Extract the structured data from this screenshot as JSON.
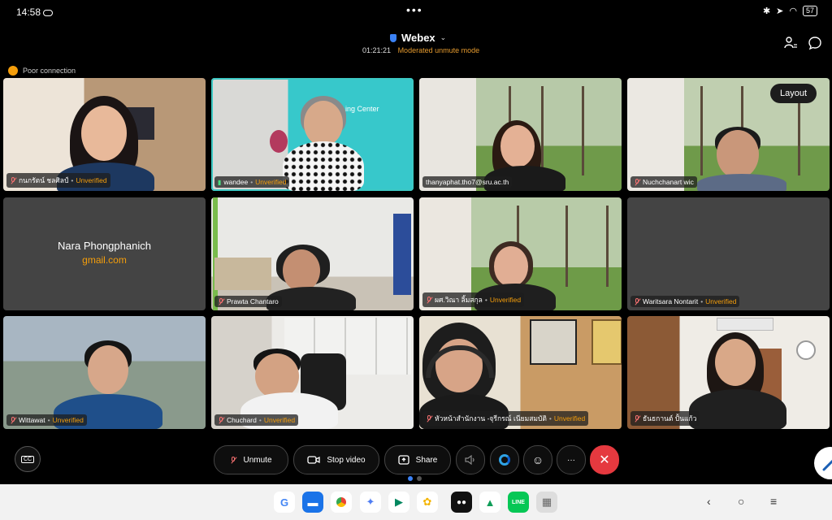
{
  "status": {
    "time": "14:58",
    "battery": "57"
  },
  "header": {
    "app_title": "Webex",
    "timer": "01:21:21",
    "mode": "Moderated unmute mode"
  },
  "connection": {
    "text": "Poor connection"
  },
  "layout_button": "Layout",
  "tiles": [
    {
      "name": "กนกรัตน์ ชลศิลป์",
      "unverified": "Unverified",
      "muted": true
    },
    {
      "name": "wandee",
      "unverified": "Unverified",
      "muted": false,
      "sign": "ing Center"
    },
    {
      "name": "thanyaphat.tho7@sru.ac.th",
      "unverified": "",
      "muted": false
    },
    {
      "name": "Nuchchanart wic",
      "unverified": "",
      "muted": true
    },
    {
      "name": "Nara Phongphanich",
      "email": "gmail.com"
    },
    {
      "name": "Prawta Chantaro",
      "unverified": "",
      "muted": true
    },
    {
      "name": "ผศ.วิณา ลิ้มสกุล",
      "unverified": "Unverified",
      "muted": true
    },
    {
      "name": "Waritsara Nontarit",
      "unverified": "Unverified",
      "muted": true
    },
    {
      "name": "Wittawat",
      "unverified": "Unverified",
      "muted": true
    },
    {
      "name": "Chuchard",
      "unverified": "Unverified",
      "muted": true
    },
    {
      "name": "หัวหน้าสำนักงาน -จุรีกรณ์ เนียมสมบัติ",
      "unverified": "Unverified",
      "muted": true
    },
    {
      "name": "ธันธกานต์ ปั้นแก้ว",
      "unverified": "",
      "muted": true
    }
  ],
  "controls": {
    "cc": "CC",
    "unmute": "Unmute",
    "stop_video": "Stop video",
    "share": "Share",
    "more": "···"
  },
  "colors": {
    "accent": "#3b82f6",
    "unverified": "#f59e0b",
    "end": "#e5393f",
    "active_border": "#3cc8c3"
  },
  "dock": [
    "G",
    "messages-icon",
    "chrome-icon",
    "gemini-icon",
    "play-store-icon",
    "photos-icon",
    "webex-icon",
    "drive-icon",
    "LINE",
    "apps-grid-icon"
  ]
}
